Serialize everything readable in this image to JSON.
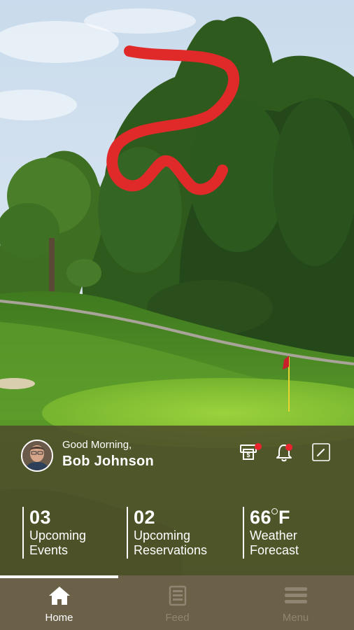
{
  "header": {
    "greeting": "Good Morning,",
    "user_name": "Bob Johnson",
    "icons": [
      "bill-icon",
      "notification-bell-icon",
      "edit-icon"
    ],
    "badge_color": "#e8242f"
  },
  "stats": [
    {
      "value": "03",
      "line1": "Upcoming",
      "line2": "Events"
    },
    {
      "value": "02",
      "line1": "Upcoming",
      "line2": "Reservations"
    },
    {
      "value": "66",
      "unit": "F",
      "line1": "Weather",
      "line2": "Forecast"
    }
  ],
  "tabs": [
    {
      "label": "Home",
      "icon": "home-icon",
      "active": true
    },
    {
      "label": "Feed",
      "icon": "feed-icon",
      "active": false
    },
    {
      "label": "Menu",
      "icon": "menu-icon",
      "active": false
    }
  ],
  "colors": {
    "overlay": "#4e4c2a",
    "tabbar": "#6b6048",
    "logo": "#e02a2a"
  }
}
